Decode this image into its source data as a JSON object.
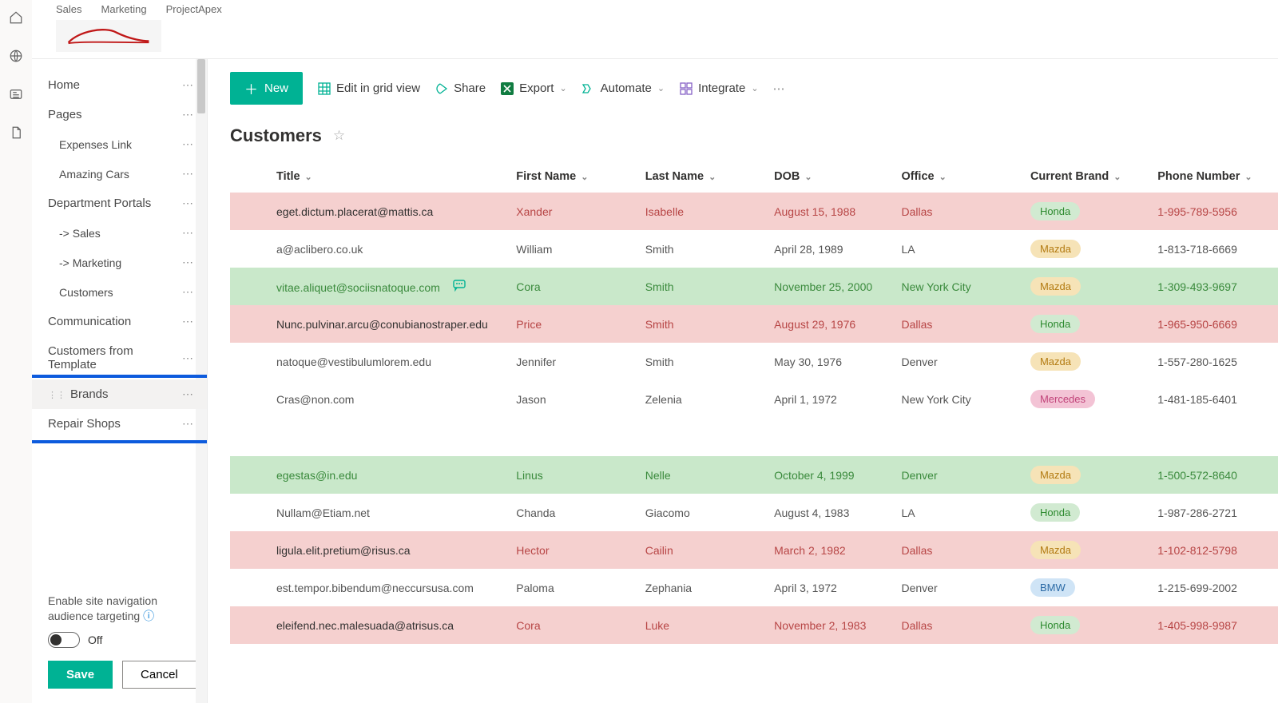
{
  "topnav": {
    "items": [
      "Sales",
      "Marketing",
      "ProjectApex"
    ]
  },
  "apprail": {
    "items": [
      "home-icon",
      "globe-icon",
      "news-icon",
      "document-icon"
    ]
  },
  "leftnav": {
    "items": [
      {
        "label": "Home",
        "sub": false
      },
      {
        "label": "Pages",
        "sub": false
      },
      {
        "label": "Expenses Link",
        "sub": true
      },
      {
        "label": "Amazing Cars",
        "sub": true
      },
      {
        "label": "Department Portals",
        "sub": false
      },
      {
        "label": "-> Sales",
        "sub": true
      },
      {
        "label": "-> Marketing",
        "sub": true
      },
      {
        "label": "Customers",
        "sub": true
      },
      {
        "label": "Communication",
        "sub": false
      },
      {
        "label": "Customers from Template",
        "sub": false
      },
      {
        "label": "Brands",
        "sub": false,
        "hovered": true,
        "drag": true
      },
      {
        "label": "Repair Shops",
        "sub": false
      }
    ],
    "callout_start_index": 10,
    "callout_end_index": 11,
    "footer": {
      "label": "Enable site navigation audience targeting",
      "toggle_state": "Off",
      "save": "Save",
      "cancel": "Cancel"
    }
  },
  "commandbar": {
    "new": "New",
    "edit_grid": "Edit in grid view",
    "share": "Share",
    "export": "Export",
    "automate": "Automate",
    "integrate": "Integrate"
  },
  "list": {
    "title": "Customers",
    "columns": [
      "Title",
      "First Name",
      "Last Name",
      "DOB",
      "Office",
      "Current Brand",
      "Phone Number"
    ],
    "rows": [
      {
        "title": "eget.dictum.placerat@mattis.ca",
        "first": "Xander",
        "last": "Isabelle",
        "dob": "August 15, 1988",
        "office": "Dallas",
        "brand": "Honda",
        "brandClass": "honda",
        "phone": "1-995-789-5956",
        "rowClass": "pink",
        "comment": false
      },
      {
        "title": "a@aclibero.co.uk",
        "first": "William",
        "last": "Smith",
        "dob": "April 28, 1989",
        "office": "LA",
        "brand": "Mazda",
        "brandClass": "mazda",
        "phone": "1-813-718-6669",
        "rowClass": "plainrow",
        "comment": false
      },
      {
        "title": "vitae.aliquet@sociisnatoque.com",
        "first": "Cora",
        "last": "Smith",
        "dob": "November 25, 2000",
        "office": "New York City",
        "brand": "Mazda",
        "brandClass": "mazda",
        "phone": "1-309-493-9697",
        "rowClass": "green",
        "comment": true
      },
      {
        "title": "Nunc.pulvinar.arcu@conubianostraper.edu",
        "first": "Price",
        "last": "Smith",
        "dob": "August 29, 1976",
        "office": "Dallas",
        "brand": "Honda",
        "brandClass": "honda",
        "phone": "1-965-950-6669",
        "rowClass": "pink",
        "comment": false
      },
      {
        "title": "natoque@vestibulumlorem.edu",
        "first": "Jennifer",
        "last": "Smith",
        "dob": "May 30, 1976",
        "office": "Denver",
        "brand": "Mazda",
        "brandClass": "mazda",
        "phone": "1-557-280-1625",
        "rowClass": "plainrow",
        "comment": false
      },
      {
        "title": "Cras@non.com",
        "first": "Jason",
        "last": "Zelenia",
        "dob": "April 1, 1972",
        "office": "New York City",
        "brand": "Mercedes",
        "brandClass": "mercedes",
        "phone": "1-481-185-6401",
        "rowClass": "plainrow",
        "comment": false
      },
      {
        "gap": true
      },
      {
        "title": "egestas@in.edu",
        "first": "Linus",
        "last": "Nelle",
        "dob": "October 4, 1999",
        "office": "Denver",
        "brand": "Mazda",
        "brandClass": "mazda",
        "phone": "1-500-572-8640",
        "rowClass": "green",
        "comment": false
      },
      {
        "title": "Nullam@Etiam.net",
        "first": "Chanda",
        "last": "Giacomo",
        "dob": "August 4, 1983",
        "office": "LA",
        "brand": "Honda",
        "brandClass": "honda",
        "phone": "1-987-286-2721",
        "rowClass": "plainrow",
        "comment": false
      },
      {
        "title": "ligula.elit.pretium@risus.ca",
        "first": "Hector",
        "last": "Cailin",
        "dob": "March 2, 1982",
        "office": "Dallas",
        "brand": "Mazda",
        "brandClass": "mazda",
        "phone": "1-102-812-5798",
        "rowClass": "pink",
        "comment": false
      },
      {
        "title": "est.tempor.bibendum@neccursusa.com",
        "first": "Paloma",
        "last": "Zephania",
        "dob": "April 3, 1972",
        "office": "Denver",
        "brand": "BMW",
        "brandClass": "bmw",
        "phone": "1-215-699-2002",
        "rowClass": "plainrow",
        "comment": false
      },
      {
        "title": "eleifend.nec.malesuada@atrisus.ca",
        "first": "Cora",
        "last": "Luke",
        "dob": "November 2, 1983",
        "office": "Dallas",
        "brand": "Honda",
        "brandClass": "honda",
        "phone": "1-405-998-9987",
        "rowClass": "pink",
        "comment": false
      }
    ]
  }
}
